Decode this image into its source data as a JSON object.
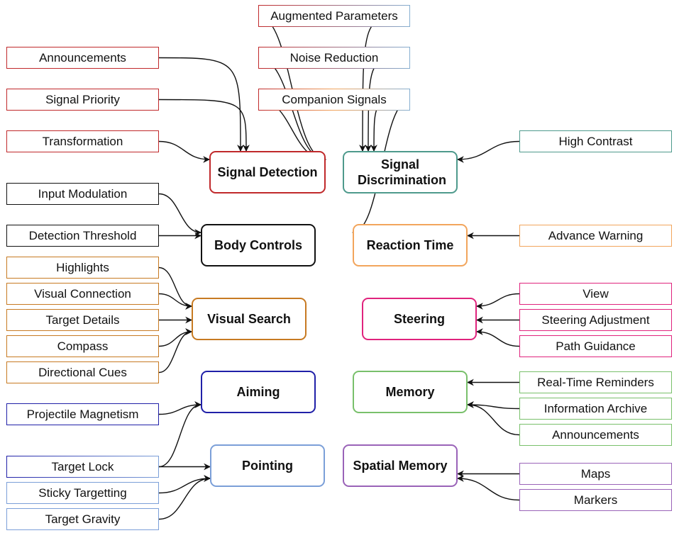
{
  "colors": {
    "red": "#c0292b",
    "teal": "#4e9a8c",
    "black": "#111111",
    "orange": "#c77a22",
    "light_orange": "#f2a55c",
    "pink": "#e0237d",
    "green": "#79c06b",
    "navy": "#2020a8",
    "light_blue": "#7b9fd8",
    "purple": "#9a63b8",
    "sky": "#86aed0",
    "edge": "#111111"
  },
  "hubs": {
    "signal_detection": {
      "label": "Signal Detection",
      "color": "red"
    },
    "signal_discrimination": {
      "label": "Signal Discrimination",
      "color": "teal"
    },
    "body_controls": {
      "label": "Body Controls",
      "color": "black"
    },
    "reaction_time": {
      "label": "Reaction Time",
      "color": "light_orange"
    },
    "visual_search": {
      "label": "Visual Search",
      "color": "orange"
    },
    "steering": {
      "label": "Steering",
      "color": "pink"
    },
    "aiming": {
      "label": "Aiming",
      "color": "navy"
    },
    "memory": {
      "label": "Memory",
      "color": "green"
    },
    "pointing": {
      "label": "Pointing",
      "color": "light_blue"
    },
    "spatial_memory": {
      "label": "Spatial Memory",
      "color": "purple"
    }
  },
  "leaves": {
    "augmented_parameters": {
      "label": "Augmented Parameters",
      "colors": [
        "red",
        "sky"
      ]
    },
    "announcements_top": {
      "label": "Announcements",
      "colors": [
        "red"
      ]
    },
    "noise_reduction": {
      "label": "Noise Reduction",
      "colors": [
        "red",
        "sky"
      ]
    },
    "signal_priority": {
      "label": "Signal Priority",
      "colors": [
        "red"
      ]
    },
    "companion_signals": {
      "label": "Companion Signals",
      "colors": [
        "red",
        "light_orange",
        "sky"
      ]
    },
    "transformation": {
      "label": "Transformation",
      "colors": [
        "red"
      ]
    },
    "high_contrast": {
      "label": "High Contrast",
      "colors": [
        "teal"
      ]
    },
    "input_modulation": {
      "label": "Input Modulation",
      "colors": [
        "black"
      ]
    },
    "detection_threshold": {
      "label": "Detection Threshold",
      "colors": [
        "black"
      ]
    },
    "advance_warning": {
      "label": "Advance Warning",
      "colors": [
        "light_orange"
      ]
    },
    "highlights": {
      "label": "Highlights",
      "colors": [
        "orange"
      ]
    },
    "visual_connection": {
      "label": "Visual Connection",
      "colors": [
        "orange"
      ]
    },
    "target_details": {
      "label": "Target Details",
      "colors": [
        "orange"
      ]
    },
    "compass": {
      "label": "Compass",
      "colors": [
        "orange"
      ]
    },
    "directional_cues": {
      "label": "Directional Cues",
      "colors": [
        "orange"
      ]
    },
    "view": {
      "label": "View",
      "colors": [
        "pink"
      ]
    },
    "steering_adjustment": {
      "label": "Steering Adjustment",
      "colors": [
        "pink"
      ]
    },
    "path_guidance": {
      "label": "Path Guidance",
      "colors": [
        "pink"
      ]
    },
    "projectile_magnetism": {
      "label": "Projectile Magnetism",
      "colors": [
        "navy"
      ]
    },
    "real_time_reminders": {
      "label": "Real-Time Reminders",
      "colors": [
        "green"
      ]
    },
    "information_archive": {
      "label": "Information Archive",
      "colors": [
        "green"
      ]
    },
    "announcements_bottom": {
      "label": "Announcements",
      "colors": [
        "green"
      ]
    },
    "target_lock": {
      "label": "Target Lock",
      "colors": [
        "navy",
        "light_blue"
      ]
    },
    "sticky_targetting": {
      "label": "Sticky Targetting",
      "colors": [
        "light_blue"
      ]
    },
    "target_gravity": {
      "label": "Target Gravity",
      "colors": [
        "light_blue"
      ]
    },
    "maps": {
      "label": "Maps",
      "colors": [
        "purple"
      ]
    },
    "markers": {
      "label": "Markers",
      "colors": [
        "purple"
      ]
    }
  },
  "edges": [
    {
      "from": "augmented_parameters",
      "to": "signal_detection"
    },
    {
      "from": "augmented_parameters",
      "to": "signal_discrimination"
    },
    {
      "from": "noise_reduction",
      "to": "signal_detection"
    },
    {
      "from": "noise_reduction",
      "to": "signal_discrimination"
    },
    {
      "from": "announcements_top",
      "to": "signal_detection"
    },
    {
      "from": "signal_priority",
      "to": "signal_detection"
    },
    {
      "from": "transformation",
      "to": "signal_detection"
    },
    {
      "from": "companion_signals",
      "to": "signal_detection"
    },
    {
      "from": "companion_signals",
      "to": "signal_discrimination"
    },
    {
      "from": "companion_signals",
      "to": "reaction_time"
    },
    {
      "from": "high_contrast",
      "to": "signal_discrimination"
    },
    {
      "from": "input_modulation",
      "to": "body_controls"
    },
    {
      "from": "detection_threshold",
      "to": "body_controls"
    },
    {
      "from": "advance_warning",
      "to": "reaction_time"
    },
    {
      "from": "highlights",
      "to": "visual_search"
    },
    {
      "from": "visual_connection",
      "to": "visual_search"
    },
    {
      "from": "target_details",
      "to": "visual_search"
    },
    {
      "from": "compass",
      "to": "visual_search"
    },
    {
      "from": "directional_cues",
      "to": "visual_search"
    },
    {
      "from": "view",
      "to": "steering"
    },
    {
      "from": "steering_adjustment",
      "to": "steering"
    },
    {
      "from": "path_guidance",
      "to": "steering"
    },
    {
      "from": "projectile_magnetism",
      "to": "aiming"
    },
    {
      "from": "target_lock",
      "to": "aiming"
    },
    {
      "from": "target_lock",
      "to": "pointing"
    },
    {
      "from": "sticky_targetting",
      "to": "pointing"
    },
    {
      "from": "target_gravity",
      "to": "pointing"
    },
    {
      "from": "real_time_reminders",
      "to": "memory"
    },
    {
      "from": "information_archive",
      "to": "memory"
    },
    {
      "from": "announcements_bottom",
      "to": "memory"
    },
    {
      "from": "maps",
      "to": "spatial_memory"
    },
    {
      "from": "markers",
      "to": "spatial_memory"
    }
  ]
}
